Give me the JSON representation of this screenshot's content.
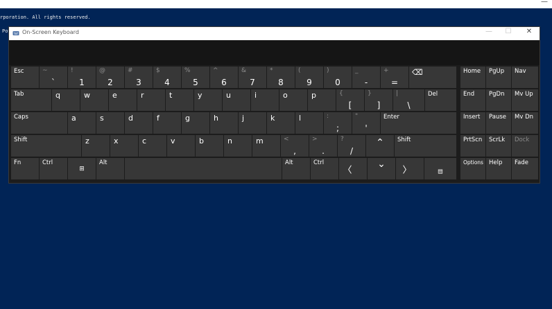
{
  "background_console": {
    "line1": "rporation. All rights reserved.",
    "line2": "Pov",
    "close_glyph": "—"
  },
  "osk": {
    "title": "On-Screen Keyboard",
    "minimize_glyph": "—",
    "maximize_glyph": "☐",
    "close_glyph": "✕"
  },
  "keys": {
    "esc": "Esc",
    "backtick": {
      "shift": "~",
      "main": "`"
    },
    "n1": {
      "shift": "!",
      "main": "1"
    },
    "n2": {
      "shift": "@",
      "main": "2"
    },
    "n3": {
      "shift": "#",
      "main": "3"
    },
    "n4": {
      "shift": "$",
      "main": "4"
    },
    "n5": {
      "shift": "%",
      "main": "5"
    },
    "n6": {
      "shift": "^",
      "main": "6"
    },
    "n7": {
      "shift": "&",
      "main": "7"
    },
    "n8": {
      "shift": "*",
      "main": "8"
    },
    "n9": {
      "shift": "(",
      "main": "9"
    },
    "n0": {
      "shift": ")",
      "main": "0"
    },
    "minus": {
      "shift": "_",
      "main": "-"
    },
    "equals": {
      "shift": "+",
      "main": "="
    },
    "backspace": "⌫",
    "tab": "Tab",
    "q": "q",
    "w": "w",
    "e": "e",
    "r": "r",
    "t": "t",
    "y": "y",
    "u": "u",
    "i": "i",
    "o": "o",
    "p": "p",
    "lbracket": {
      "shift": "{",
      "main": "["
    },
    "rbracket": {
      "shift": "}",
      "main": "]"
    },
    "backslash": {
      "shift": "|",
      "main": "\\"
    },
    "del": "Del",
    "caps": "Caps",
    "a": "a",
    "s": "s",
    "d": "d",
    "f": "f",
    "g": "g",
    "h": "h",
    "j": "j",
    "k": "k",
    "l": "l",
    "semicolon": {
      "shift": ":",
      "main": ";"
    },
    "quote": {
      "shift": "\"",
      "main": "'"
    },
    "enter": "Enter",
    "shift_left": "Shift",
    "z": "z",
    "x": "x",
    "c": "c",
    "v": "v",
    "b": "b",
    "n": "n",
    "m": "m",
    "comma": {
      "shift": "<",
      "main": ","
    },
    "period": {
      "shift": ">",
      "main": "."
    },
    "slash": {
      "shift": "?",
      "main": "/"
    },
    "up": "⌃",
    "shift_right": "Shift",
    "fn": "Fn",
    "ctrl_left": "Ctrl",
    "win": "⊞",
    "alt_left": "Alt",
    "alt_right": "Alt",
    "ctrl_right": "Ctrl",
    "left": "〈",
    "down": "⌄",
    "right": "〉",
    "menu": "▤",
    "home": "Home",
    "pgup": "PgUp",
    "nav": "Nav",
    "end": "End",
    "pgdn": "PgDn",
    "mvup": "Mv Up",
    "insert": "Insert",
    "pause": "Pause",
    "mvdn": "Mv Dn",
    "prtscn": "PrtScn",
    "scrlk": "ScrLk",
    "dock": "Dock",
    "options": "Options",
    "help": "Help",
    "fade": "Fade"
  },
  "colors": {
    "desktop": "#012456",
    "key": "#373737",
    "osk_bg": "#1c1c1c"
  }
}
